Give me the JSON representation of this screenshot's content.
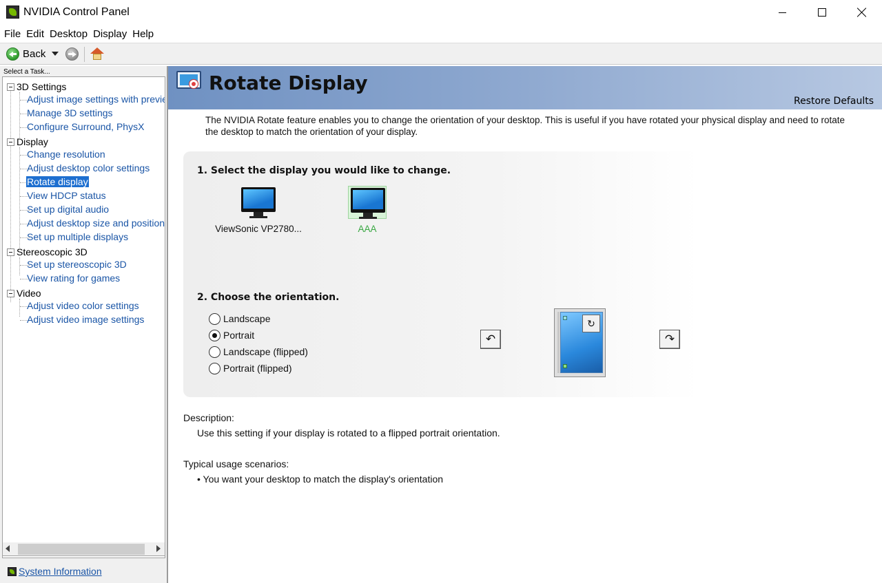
{
  "window": {
    "title": "NVIDIA Control Panel",
    "controls": [
      "minimize-icon",
      "maximize-icon",
      "close-icon"
    ]
  },
  "menu": [
    "File",
    "Edit",
    "Desktop",
    "Display",
    "Help"
  ],
  "toolbar": {
    "back_label": "Back",
    "icons": [
      "back-icon",
      "dropdown-arrow-icon",
      "forward-icon",
      "home-icon"
    ]
  },
  "sidebar": {
    "task_header": "Select a Task...",
    "categories": [
      {
        "label": "3D Settings",
        "items": [
          "Adjust image settings with preview",
          "Manage 3D settings",
          "Configure Surround, PhysX"
        ]
      },
      {
        "label": "Display",
        "items": [
          "Change resolution",
          "Adjust desktop color settings",
          "Rotate display",
          "View HDCP status",
          "Set up digital audio",
          "Adjust desktop size and position",
          "Set up multiple displays"
        ]
      },
      {
        "label": "Stereoscopic 3D",
        "items": [
          "Set up stereoscopic 3D",
          "View rating for games"
        ]
      },
      {
        "label": "Video",
        "items": [
          "Adjust video color settings",
          "Adjust video image settings"
        ]
      }
    ],
    "selected_item": "Rotate display",
    "system_info_label": "System Information"
  },
  "page": {
    "title": "Rotate Display",
    "restore_defaults": "Restore Defaults",
    "intro": "The NVIDIA Rotate feature enables you to change the orientation of your desktop. This is useful if you have rotated your physical display and need to rotate the desktop to match the orientation of your display.",
    "step1": "1. Select the display you would like to change.",
    "displays": [
      {
        "name": "ViewSonic VP2780...",
        "selected": false
      },
      {
        "name": "AAA",
        "selected": true
      }
    ],
    "step2": "2. Choose the orientation.",
    "orientations": [
      {
        "label": "Landscape",
        "checked": false
      },
      {
        "label": "Portrait",
        "checked": true
      },
      {
        "label": "Landscape (flipped)",
        "checked": false
      },
      {
        "label": "Portrait (flipped)",
        "checked": false
      }
    ],
    "rotate_left_icon": "↶",
    "rotate_right_icon": "↷",
    "description_heading": "Description:",
    "description_text": "Use this setting if your display is rotated to a flipped portrait orientation.",
    "usage_heading": "Typical usage scenarios:",
    "usage_items": [
      "• You want your desktop to match the display's orientation"
    ]
  },
  "colors": {
    "banner_start": "#6f91c2",
    "banner_end": "#b7c8e2",
    "link": "#1a55a6",
    "selected_bg": "#1e6fd0",
    "selected_display": "#3aa843",
    "nvidia_green": "#76b900"
  }
}
